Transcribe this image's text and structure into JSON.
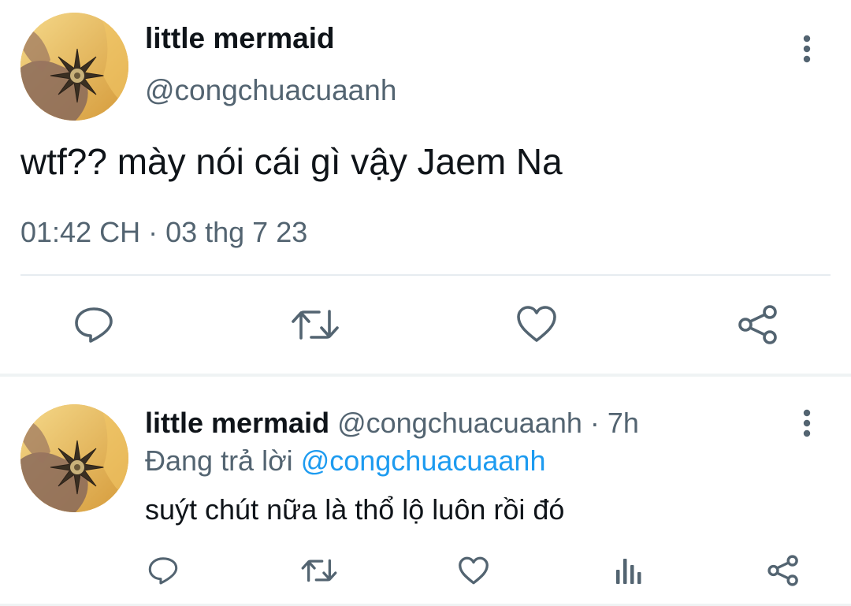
{
  "main_tweet": {
    "display_name": "little mermaid",
    "handle": "@congchuacuaanh",
    "text": "wtf?? mày nói cái gì vậy Jaem Na",
    "timestamp": "01:42 CH · 03 thg 7 23",
    "avatar_icon": "avatar-image",
    "more_icon": "more-vertical-icon",
    "actions": [
      "reply-icon",
      "retweet-icon",
      "like-icon",
      "share-icon"
    ]
  },
  "reply_tweet": {
    "display_name": "little mermaid",
    "handle": "@congchuacuaanh",
    "separator": " · ",
    "time_ago": "7h",
    "replying_prefix": "Đang trả lời ",
    "replying_to": "@congchuacuaanh",
    "text": "suýt chút nữa là thổ lộ luôn rồi đó",
    "more_icon": "more-vertical-icon",
    "actions": [
      "reply-icon",
      "retweet-icon",
      "like-icon",
      "analytics-icon",
      "share-icon"
    ]
  },
  "colors": {
    "text_primary": "#0f1419",
    "text_secondary": "#536471",
    "mention": "#1d9bf0",
    "icon": "#536471",
    "divider": "#e6ecf0",
    "avatar_gold": "#e7b24e"
  }
}
